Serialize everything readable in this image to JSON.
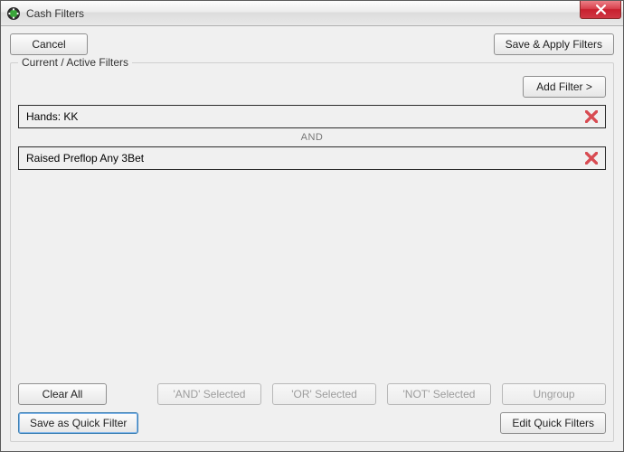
{
  "window": {
    "title": "Cash Filters"
  },
  "buttons": {
    "cancel": "Cancel",
    "save_apply": "Save & Apply Filters",
    "add_filter": "Add Filter >",
    "clear_all": "Clear All",
    "and_selected": "'AND' Selected",
    "or_selected": "'OR' Selected",
    "not_selected": "'NOT' Selected",
    "ungroup": "Ungroup",
    "save_quick": "Save as Quick Filter",
    "edit_quick": "Edit Quick Filters"
  },
  "group": {
    "legend": "Current / Active Filters"
  },
  "filters": [
    {
      "label": "Hands: KK"
    },
    {
      "label": "Raised Preflop Any 3Bet"
    }
  ],
  "connectors": {
    "and": "AND"
  }
}
